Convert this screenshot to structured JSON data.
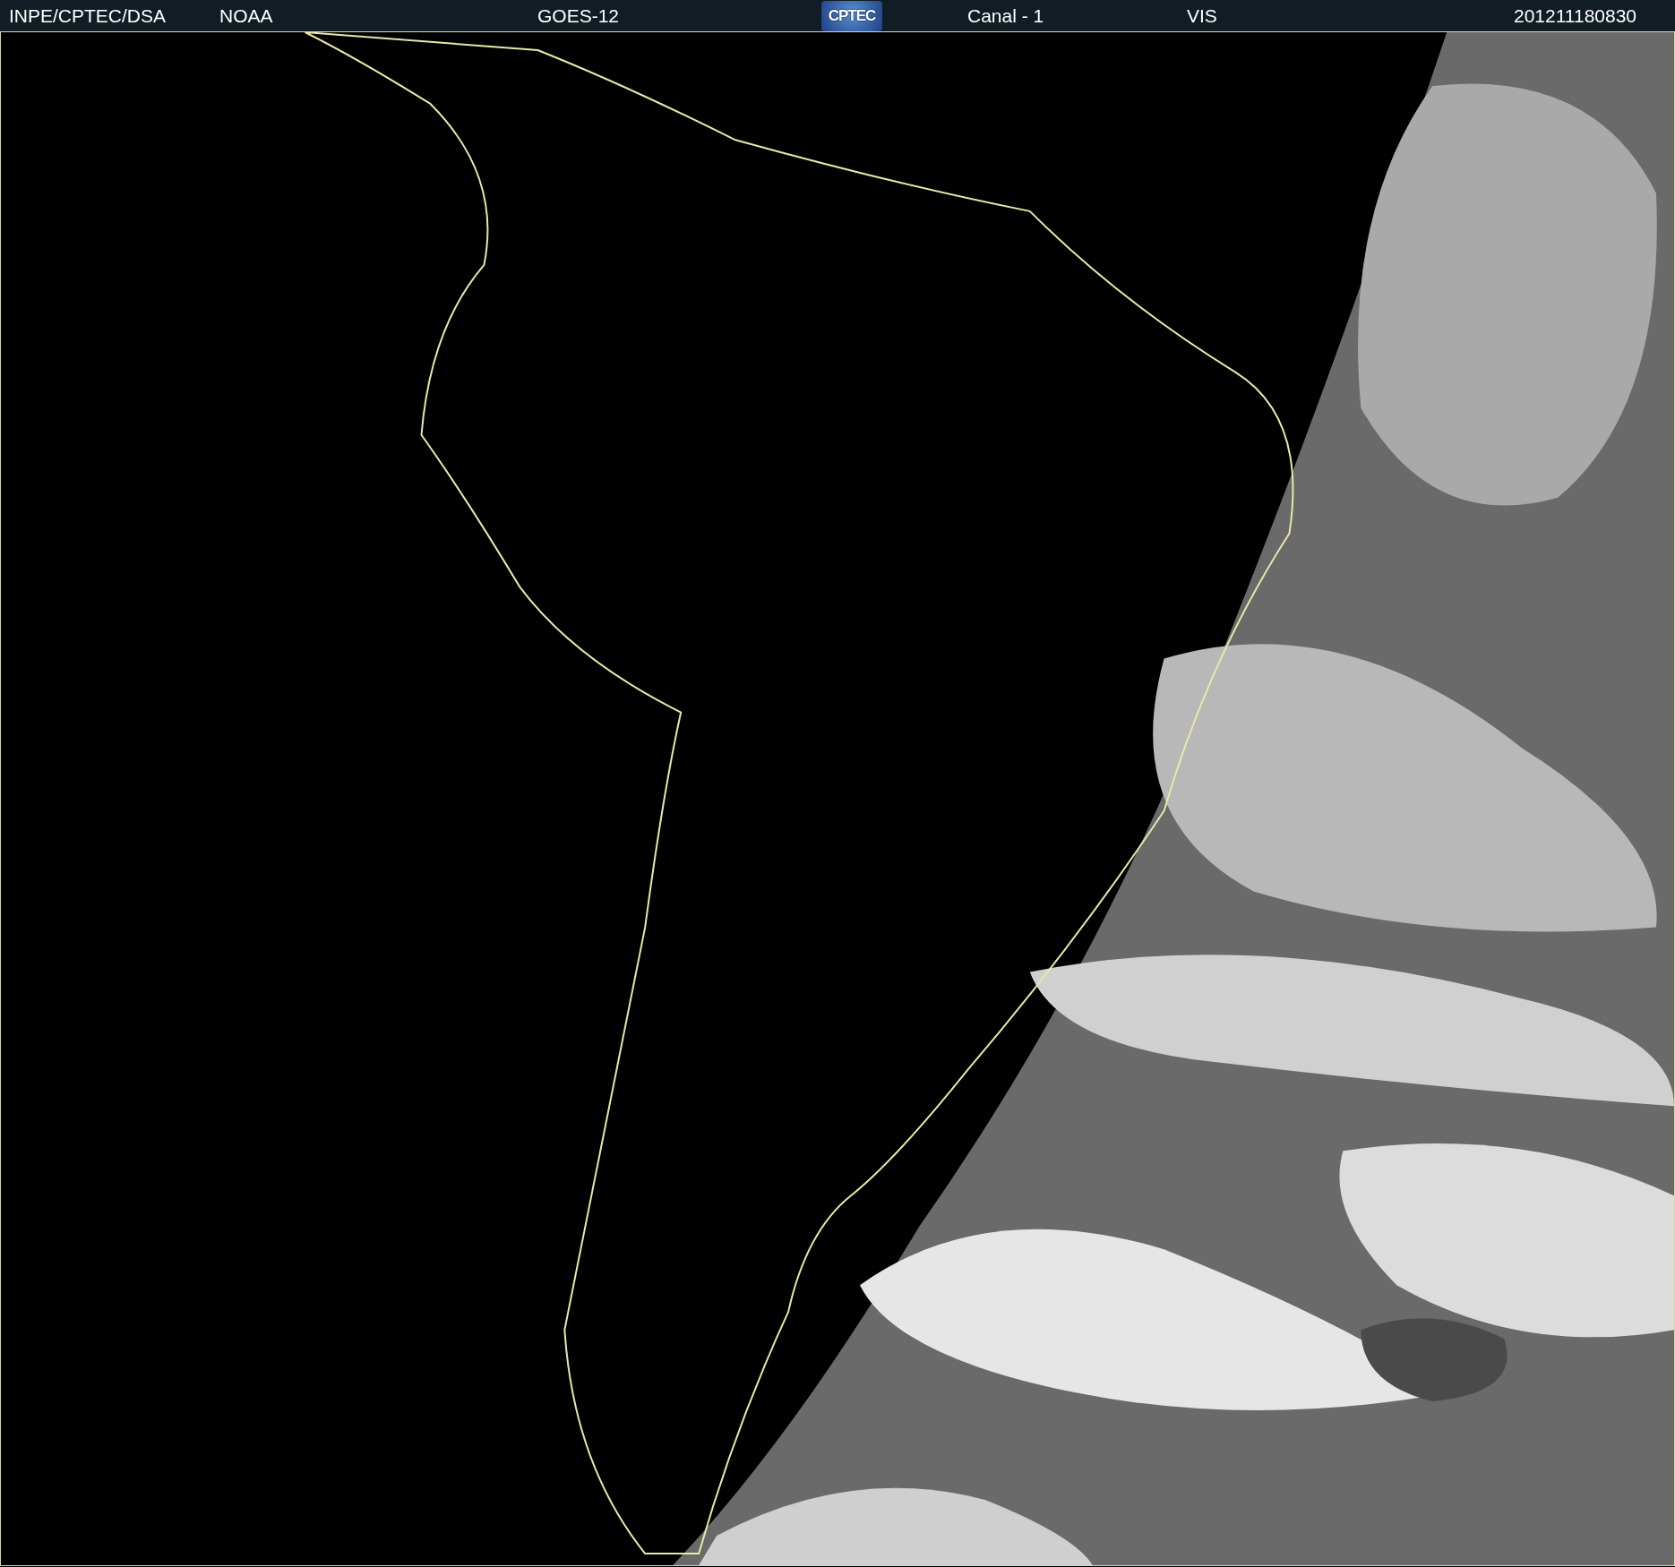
{
  "header": {
    "items": [
      {
        "kind": "text",
        "text": "INPE/CPTEC/DSA"
      },
      {
        "kind": "text",
        "text": "NOAA"
      },
      {
        "kind": "text",
        "text": "GOES-12"
      },
      {
        "kind": "logo",
        "text": "CPTEC"
      },
      {
        "kind": "text",
        "text": "Canal - 1"
      },
      {
        "kind": "text",
        "text": "VIS"
      },
      {
        "kind": "text",
        "text": "201211180830"
      }
    ]
  }
}
